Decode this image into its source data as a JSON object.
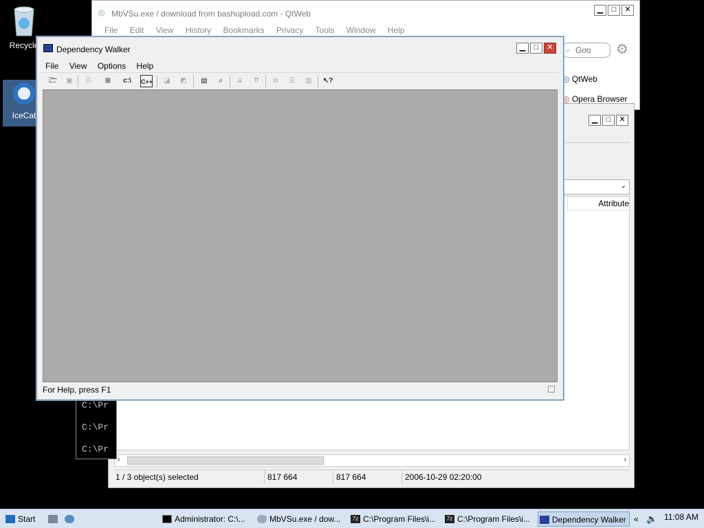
{
  "desktop": {
    "recycle_label": "Recycle",
    "icecat_label": "IceCat"
  },
  "qtweb": {
    "title": "MbVSu.exe / download from bashupload.com - QtWeb",
    "menu": [
      "File",
      "Edit",
      "View",
      "History",
      "Bookmarks",
      "Privacy",
      "Tools",
      "Window",
      "Help"
    ],
    "search_placeholder": "Goo",
    "bookmarks": [
      "QtWeb",
      "Opera Browser"
    ]
  },
  "explorer": {
    "column_header": "Attribute",
    "status": {
      "selected": "1 / 3 object(s) selected",
      "size1": "817 664",
      "size2": "817 664",
      "date": "2006-10-29 02:20:00"
    }
  },
  "console": {
    "lines": [
      "C:\\Pr",
      "C:\\Pr",
      "C:\\Pr"
    ]
  },
  "depwalk": {
    "title": "Dependency Walker",
    "menu": [
      "File",
      "View",
      "Options",
      "Help"
    ],
    "status": "For Help, press F1"
  },
  "taskbar": {
    "start": "Start",
    "items": [
      "Administrator: C:\\...",
      "MbVSu.exe / dow...",
      "C:\\Program Files\\i...",
      "C:\\Program Files\\i...",
      "Dependency Walker"
    ],
    "chevron": "«",
    "clock": "11:08 AM"
  }
}
